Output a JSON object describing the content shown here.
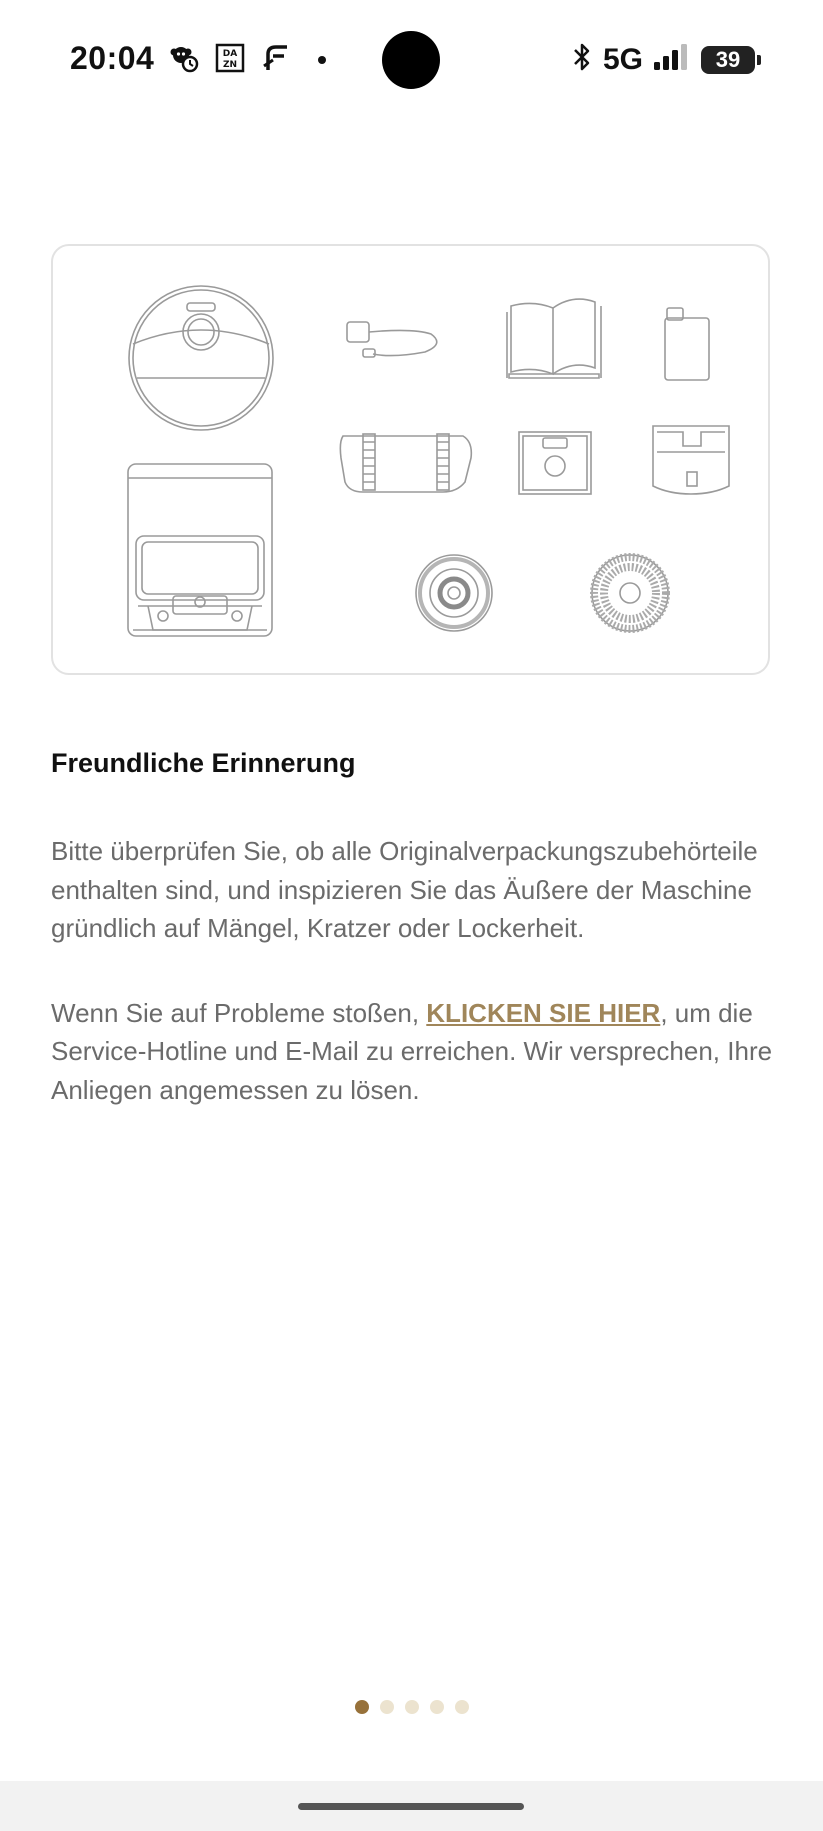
{
  "status_bar": {
    "time": "20:04",
    "left_icons": [
      "monkey-alarm-icon",
      "dazn-icon",
      "notification-app-icon",
      "more-dot-icon"
    ],
    "network": "5G",
    "battery_level": "39",
    "right_icons": [
      "bluetooth-icon",
      "signal-icon",
      "battery-icon"
    ]
  },
  "illustration": {
    "items": [
      "robot-vacuum",
      "charging-cable",
      "user-manual",
      "cleaning-solution-bottle",
      "mop-bracket",
      "dust-bag",
      "water-tank-cover",
      "station-base",
      "side-brush-mop",
      "mop-pad"
    ]
  },
  "content": {
    "title": "Freundliche Erinnerung",
    "paragraph1": "Bitte überprüfen Sie, ob alle Originalverpackungszubehörteile enthalten sind, und inspizieren Sie das Äußere der Maschine gründlich auf Mängel, Kratzer oder Lockerheit.",
    "paragraph2_before": "Wenn Sie auf Probleme stoßen, ",
    "paragraph2_link": "KLICKEN SIE HIER",
    "paragraph2_after": ", um die Service-Hotline und E-Mail zu erreichen. Wir versprechen, Ihre Anliegen angemessen zu lösen."
  },
  "pager": {
    "total": 5,
    "active_index": 0
  },
  "colors": {
    "accent_gold": "#a0865a",
    "dot_active": "#97713a",
    "dot_inactive": "#ece3cf",
    "body_text": "#6b6b6b"
  }
}
